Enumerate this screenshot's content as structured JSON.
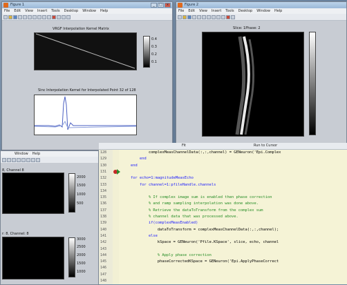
{
  "fig1": {
    "title": "Figure 1",
    "menus": [
      "File",
      "Edit",
      "View",
      "Insert",
      "Tools",
      "Desktop",
      "Window",
      "Help"
    ],
    "plot1_title": "VRGF Interpolation Kernel Matrix",
    "plot1_cb_ticks": [
      "0.4",
      "0.3",
      "0.2",
      "0.1"
    ],
    "plot2_title": "Sinc Interpolation Kernel for Interpolated Point  32 of 128"
  },
  "fig2": {
    "title": "Figure 2",
    "menus": [
      "File",
      "Edit",
      "View",
      "Insert",
      "Tools",
      "Desktop",
      "Window",
      "Help"
    ],
    "plot_title": "Slice: 1Phase: 2"
  },
  "fig3": {
    "menus": [
      "Window",
      "Help"
    ],
    "ch1": "8, Channel 8",
    "ch2": "r: 8, Channel: 8",
    "cb1": [
      "2000",
      "1500",
      "1000",
      "500"
    ],
    "cb2": [
      "3000",
      "2500",
      "2000",
      "1500",
      "1000"
    ]
  },
  "editor": {
    "toolbar": [
      "Fit",
      "Run to Cursor"
    ],
    "line_numbers": [
      "128",
      "129",
      "130",
      "131",
      "132",
      "133",
      "134",
      "135",
      "136",
      "137",
      "138",
      "139",
      "140",
      "141",
      "142",
      "143",
      "144",
      "145",
      "146",
      "147",
      "148"
    ],
    "lines": [
      "            complexMeasChannelData(:,:,channel) = GENeuron('Epi.Complex",
      "        end",
      "    end",
      "",
      "    for echo=1:magnitudeMeasEcho",
      "        for channel=1:pfileHandle.channels",
      "",
      "            % If complex image sum is enabled then phase correction",
      "            % and ramp sampling interpolation was done above.",
      "            % Retrieve the dataToTransform from the complex sum",
      "            % channel data that was processed above.",
      "            if(complexMeasEnabled)",
      "                dataToTransform = complexMeasChannelData(:,:,channel);",
      "            else",
      "                kSpace = GENeuron('Pfile.KSpace', slice, echo, channel",
      "",
      "                % Apply phase correction",
      "                phaseCorrectedKSpace = GENeuron('Epi.ApplyPhaseCorrect"
    ]
  }
}
